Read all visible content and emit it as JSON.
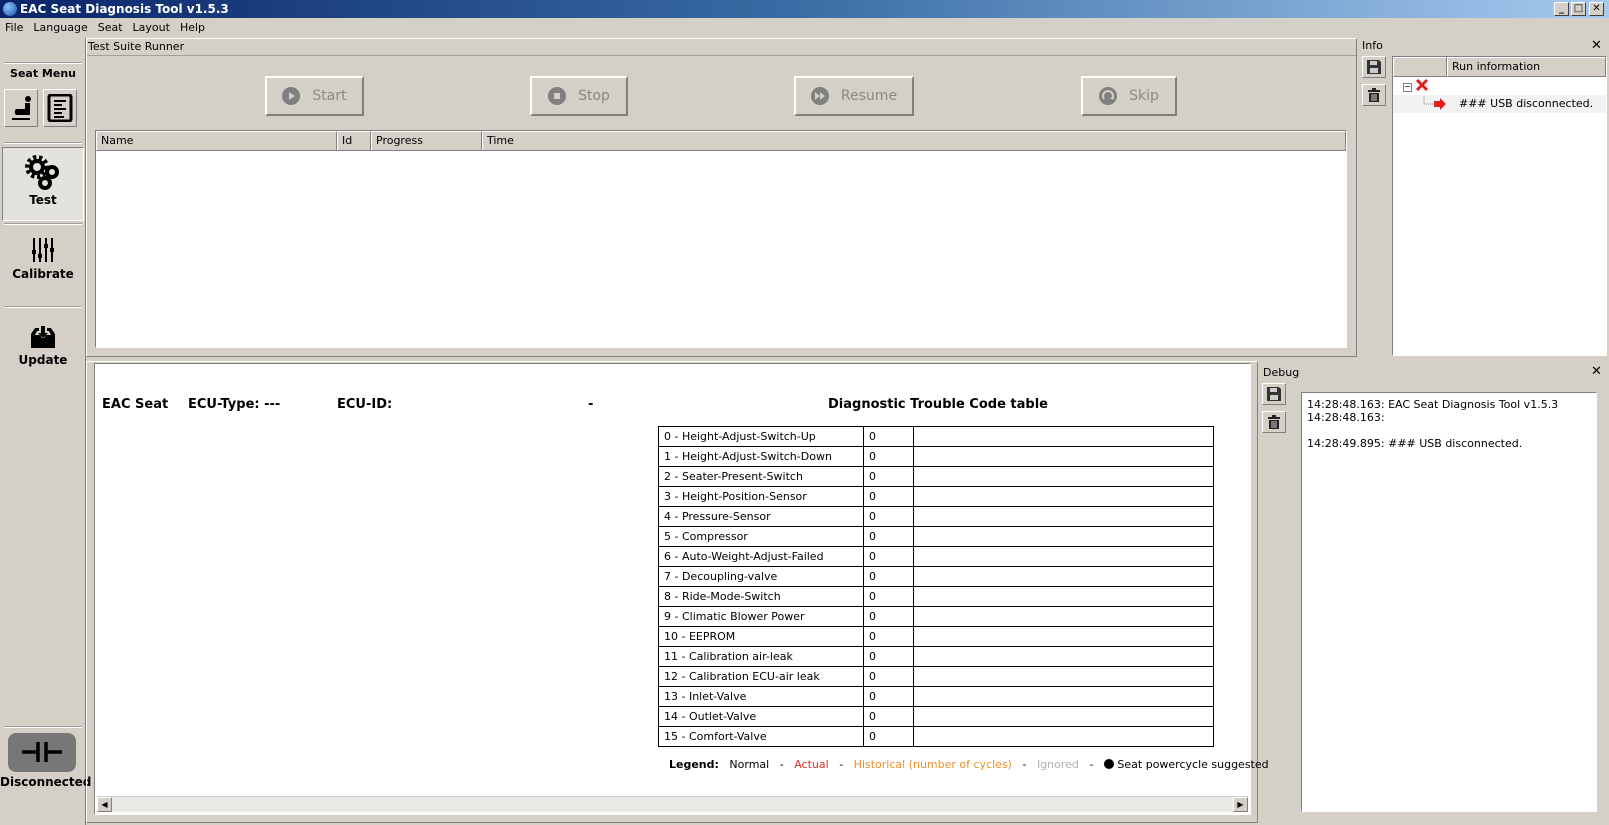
{
  "window": {
    "title": "EAC Seat Diagnosis Tool v1.5.3",
    "min": "_",
    "max": "□",
    "close": "✕"
  },
  "menu": [
    "File",
    "Language",
    "Seat",
    "Layout",
    "Help"
  ],
  "sidebar": {
    "seat_menu": "Seat Menu",
    "test": "Test",
    "calibrate": "Calibrate",
    "update": "Update",
    "status": "Disconnected"
  },
  "runner": {
    "title": "Test Suite Runner",
    "buttons": {
      "start": "Start",
      "stop": "Stop",
      "resume": "Resume",
      "skip": "Skip"
    },
    "columns": [
      "Name",
      "Id",
      "Progress",
      "Time"
    ]
  },
  "info": {
    "title": "Info",
    "column": "Run information",
    "message": "### USB disconnected.",
    "close": "✕"
  },
  "main": {
    "device": "EAC Seat",
    "ecu_type": "ECU-Type: ---",
    "ecu_id": "ECU-ID:",
    "ecu_id_value": "-",
    "dtc_title": "Diagnostic Trouble Code table",
    "dtc": [
      {
        "name": "0 - Height-Adjust-Switch-Up",
        "value": "0"
      },
      {
        "name": "1 - Height-Adjust-Switch-Down",
        "value": "0"
      },
      {
        "name": "2 - Seater-Present-Switch",
        "value": "0"
      },
      {
        "name": "3 - Height-Position-Sensor",
        "value": "0"
      },
      {
        "name": "4 - Pressure-Sensor",
        "value": "0"
      },
      {
        "name": "5 - Compressor",
        "value": "0"
      },
      {
        "name": "6 - Auto-Weight-Adjust-Failed",
        "value": "0"
      },
      {
        "name": "7 - Decoupling-valve",
        "value": "0"
      },
      {
        "name": "8 - Ride-Mode-Switch",
        "value": "0"
      },
      {
        "name": "9 - Climatic Blower Power",
        "value": "0"
      },
      {
        "name": "10 - EEPROM",
        "value": "0"
      },
      {
        "name": "11 - Calibration air-leak",
        "value": "0"
      },
      {
        "name": "12 - Calibration ECU-air leak",
        "value": "0"
      },
      {
        "name": "13 - Inlet-Valve",
        "value": "0"
      },
      {
        "name": "14 - Outlet-Valve",
        "value": "0"
      },
      {
        "name": "15 - Comfort-Valve",
        "value": "0"
      }
    ],
    "legend": {
      "label": "Legend:",
      "normal": "Normal",
      "actual": "Actual",
      "historical": "Historical (number of cycles)",
      "ignored": "Ignored",
      "powercycle": "Seat powercycle suggested",
      "sep": "-"
    }
  },
  "debug": {
    "title": "Debug",
    "close": "✕",
    "lines": [
      "14:28:48.163: EAC Seat Diagnosis Tool v1.5.3",
      "14:28:48.163:",
      "",
      "14:28:49.895: ### USB disconnected."
    ]
  },
  "colors": {
    "actual": "#e0302a",
    "historical": "#e8902a",
    "ignored": "#b0b0b0"
  }
}
